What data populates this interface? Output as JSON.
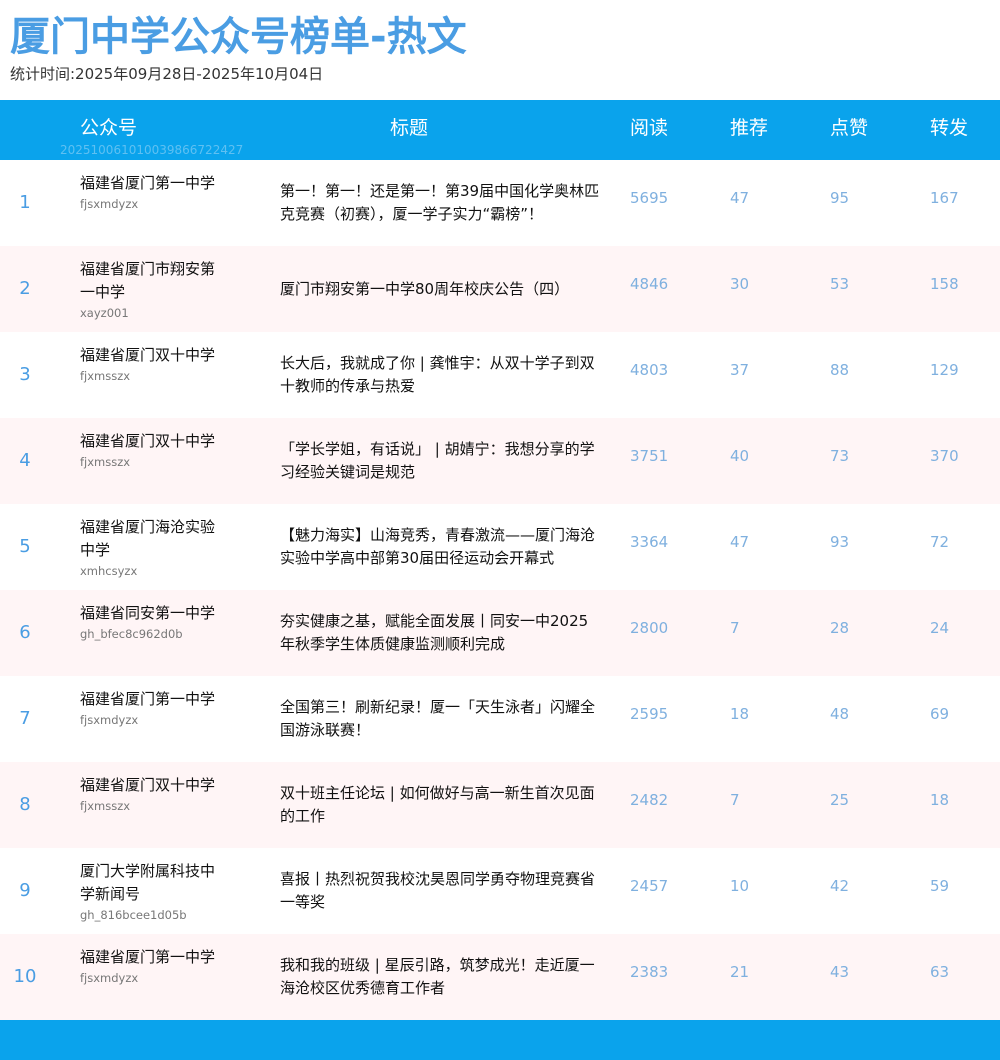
{
  "header": {
    "title": "厦门中学公众号榜单-热文",
    "period": "统计时间:2025年09月28日-2025年10月04日"
  },
  "table": {
    "columns": {
      "account": "公众号",
      "title": "标题",
      "read": "阅读",
      "recommend": "推荐",
      "like": "点赞",
      "share": "转发"
    },
    "stamp": "20251006101003986672242​7",
    "rows": [
      {
        "rank": "1",
        "account": "福建省厦门第一中学",
        "account_id": "fjsxmdyzx",
        "title": "第一！第一！还是第一！第39届中国化学奥林匹克竞赛（初赛），厦一学子实力“霸榜”！",
        "read": "5695",
        "recommend": "47",
        "like": "95",
        "share": "167"
      },
      {
        "rank": "2",
        "account": "福建省厦门市翔安第一中学",
        "account_id": "xayz001",
        "title": "厦门市翔安第一中学80周年校庆公告（四）",
        "read": "4846",
        "recommend": "30",
        "like": "53",
        "share": "158"
      },
      {
        "rank": "3",
        "account": "福建省厦门双十中学",
        "account_id": "fjxmsszx",
        "title": "长大后，我就成了你 | 龚惟宇：从双十学子到双十教师的传承与热爱",
        "read": "4803",
        "recommend": "37",
        "like": "88",
        "share": "129"
      },
      {
        "rank": "4",
        "account": "福建省厦门双十中学",
        "account_id": "fjxmsszx",
        "title": "「学长学姐，有话说」 | 胡婧宁：我想分享的学习经验关键词是规范",
        "read": "3751",
        "recommend": "40",
        "like": "73",
        "share": "370"
      },
      {
        "rank": "5",
        "account": "福建省厦门海沧实验中学",
        "account_id": "xmhcsyzx",
        "title": "【魅力海实】山海竞秀，青春激流——厦门海沧实验中学高中部第30届田径运动会开幕式",
        "read": "3364",
        "recommend": "47",
        "like": "93",
        "share": "72"
      },
      {
        "rank": "6",
        "account": "福建省同安第一中学",
        "account_id": "gh_bfec8c962d0b",
        "title": "夯实健康之基，赋能全面发展丨同安一中2025年秋季学生体质健康监测顺利完成",
        "read": "2800",
        "recommend": "7",
        "like": "28",
        "share": "24"
      },
      {
        "rank": "7",
        "account": "福建省厦门第一中学",
        "account_id": "fjsxmdyzx",
        "title": "全国第三！刷新纪录！厦一「天生泳者」闪耀全国游泳联赛！",
        "read": "2595",
        "recommend": "18",
        "like": "48",
        "share": "69"
      },
      {
        "rank": "8",
        "account": "福建省厦门双十中学",
        "account_id": "fjxmsszx",
        "title": "双十班主任论坛 | 如何做好与高一新生首次见面的工作",
        "read": "2482",
        "recommend": "7",
        "like": "25",
        "share": "18"
      },
      {
        "rank": "9",
        "account": "厦门大学附属科技中学新闻号",
        "account_id": "gh_816bcee1d05b",
        "title": "喜报丨热烈祝贺我校沈昊恩同学勇夺物理竞赛省一等奖",
        "read": "2457",
        "recommend": "10",
        "like": "42",
        "share": "59"
      },
      {
        "rank": "10",
        "account": "福建省厦门第一中学",
        "account_id": "fjsxmdyzx",
        "title": "我和我的班级 | 星辰引路，筑梦成光！走近厦一海沧校区优秀德育工作者",
        "read": "2383",
        "recommend": "21",
        "like": "43",
        "share": "63"
      }
    ]
  },
  "colors": {
    "accent": "#0aa3ec",
    "title": "#4a9de3",
    "number": "#7fb0df",
    "row_alt": "#fff5f6"
  }
}
